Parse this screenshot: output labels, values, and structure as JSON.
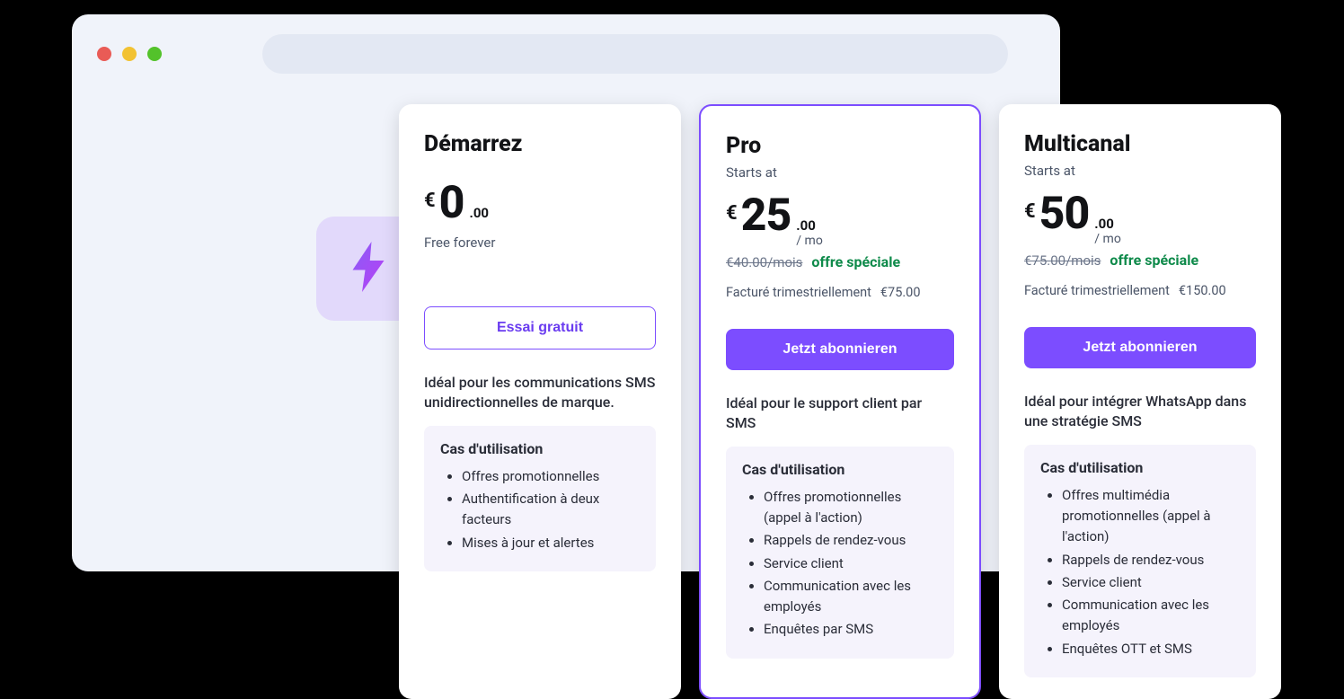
{
  "plans": [
    {
      "name": "Démarrez",
      "starts_at": "",
      "currency": "€",
      "amount": "0",
      "cents": ".00",
      "permo": "",
      "free_note": "Free forever",
      "old_price": "",
      "special": "",
      "billing_label": "",
      "billing_amount": "",
      "btn_label": "Essai gratuit",
      "btn_style": "outline",
      "ideal": "Idéal pour les communications SMS unidirectionnelles de marque.",
      "usecase_title": "Cas d'utilisation",
      "usecases": [
        "Offres promotionnelles",
        "Authentification à deux facteurs",
        "Mises à jour et alertes"
      ],
      "highlighted": false
    },
    {
      "name": "Pro",
      "starts_at": "Starts at",
      "currency": "€",
      "amount": "25",
      "cents": ".00",
      "permo": "/ mo",
      "free_note": "",
      "old_price": "€40.00/mois",
      "special": "offre spéciale",
      "billing_label": "Facturé trimestriellement",
      "billing_amount": "€75.00",
      "btn_label": "Jetzt abonnieren",
      "btn_style": "filled",
      "ideal": "Idéal pour le support client par SMS",
      "usecase_title": "Cas d'utilisation",
      "usecases": [
        "Offres promotionnelles (appel à l'action)",
        "Rappels de rendez-vous",
        "Service client",
        "Communication avec les employés",
        "Enquêtes par SMS"
      ],
      "highlighted": true
    },
    {
      "name": "Multicanal",
      "starts_at": "Starts at",
      "currency": "€",
      "amount": "50",
      "cents": ".00",
      "permo": "/ mo",
      "free_note": "",
      "old_price": "€75.00/mois",
      "special": "offre spéciale",
      "billing_label": "Facturé trimestriellement",
      "billing_amount": "€150.00",
      "btn_label": "Jetzt abonnieren",
      "btn_style": "filled",
      "ideal": "Idéal pour intégrer WhatsApp dans une stratégie SMS",
      "usecase_title": "Cas d'utilisation",
      "usecases": [
        "Offres multimédia promotionnelles (appel à l'action)",
        "Rappels de rendez-vous",
        "Service client",
        "Communication avec les employés",
        "Enquêtes OTT et SMS"
      ],
      "highlighted": false
    }
  ]
}
